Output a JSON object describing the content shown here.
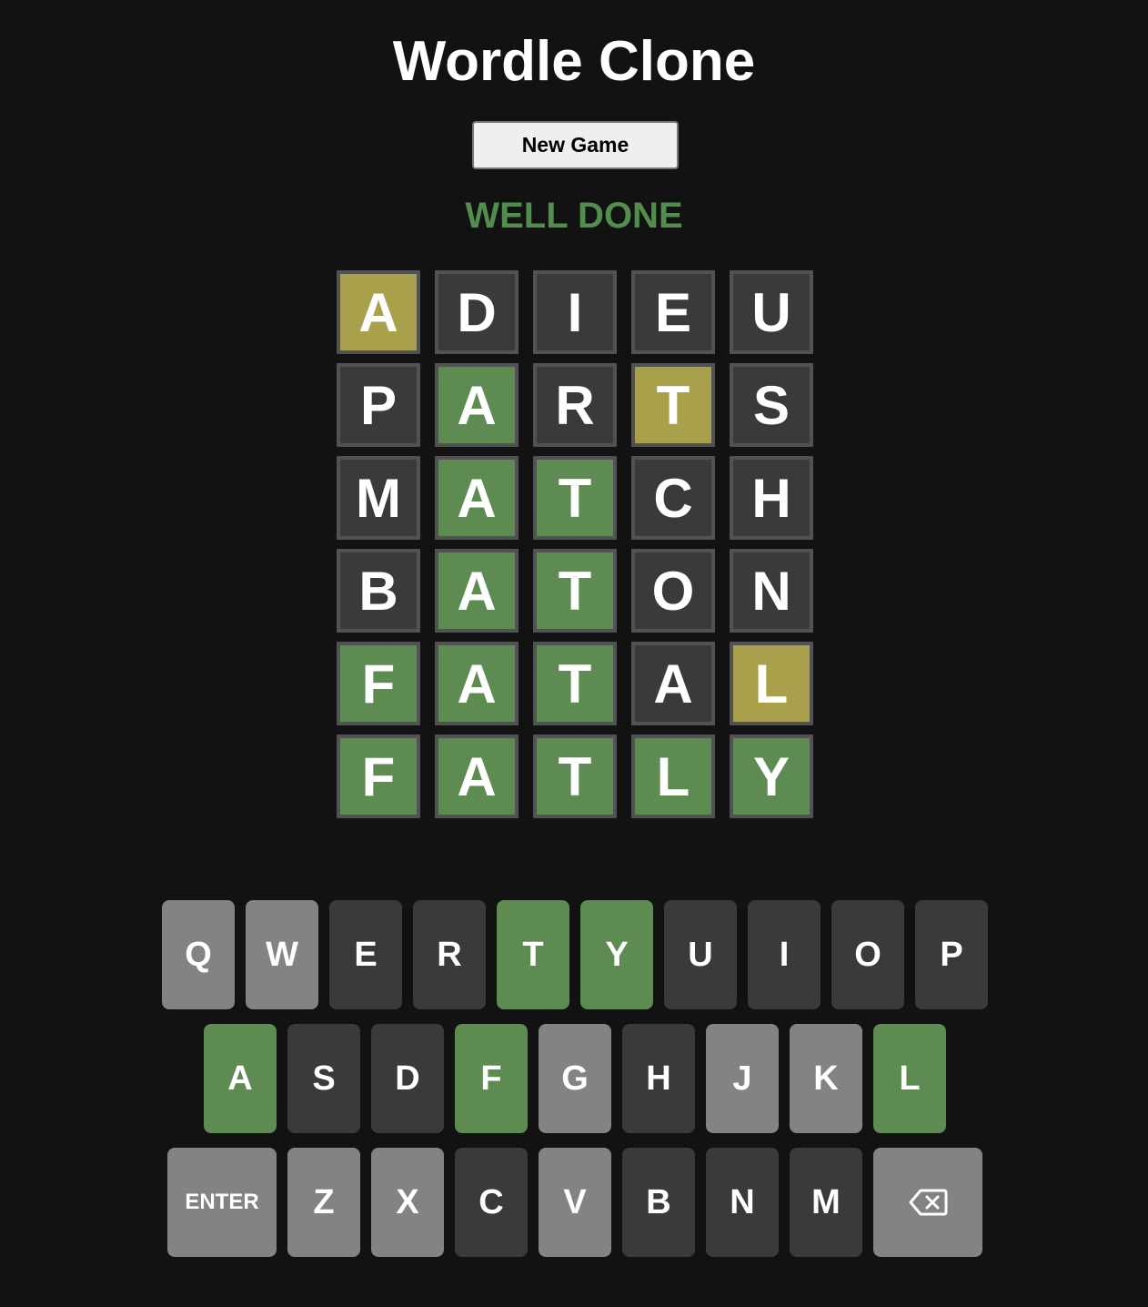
{
  "header": {
    "title": "Wordle Clone",
    "new_game_label": "New Game"
  },
  "status": {
    "message": "WELL DONE",
    "color": "#5e8b52"
  },
  "colors": {
    "background": "#121212",
    "tile_absent": "#3a3a3c",
    "tile_present": "#a9a04b",
    "tile_correct": "#5e8b52",
    "key_used_absent": "#818384",
    "key_unused": "#3a3a3c"
  },
  "board": {
    "rows": [
      [
        {
          "letter": "A",
          "state": "present"
        },
        {
          "letter": "D",
          "state": "absent"
        },
        {
          "letter": "I",
          "state": "absent"
        },
        {
          "letter": "E",
          "state": "absent"
        },
        {
          "letter": "U",
          "state": "absent"
        }
      ],
      [
        {
          "letter": "P",
          "state": "absent"
        },
        {
          "letter": "A",
          "state": "correct"
        },
        {
          "letter": "R",
          "state": "absent"
        },
        {
          "letter": "T",
          "state": "present"
        },
        {
          "letter": "S",
          "state": "absent"
        }
      ],
      [
        {
          "letter": "M",
          "state": "absent"
        },
        {
          "letter": "A",
          "state": "correct"
        },
        {
          "letter": "T",
          "state": "correct"
        },
        {
          "letter": "C",
          "state": "absent"
        },
        {
          "letter": "H",
          "state": "absent"
        }
      ],
      [
        {
          "letter": "B",
          "state": "absent"
        },
        {
          "letter": "A",
          "state": "correct"
        },
        {
          "letter": "T",
          "state": "correct"
        },
        {
          "letter": "O",
          "state": "absent"
        },
        {
          "letter": "N",
          "state": "absent"
        }
      ],
      [
        {
          "letter": "F",
          "state": "correct"
        },
        {
          "letter": "A",
          "state": "correct"
        },
        {
          "letter": "T",
          "state": "correct"
        },
        {
          "letter": "A",
          "state": "absent"
        },
        {
          "letter": "L",
          "state": "present"
        }
      ],
      [
        {
          "letter": "F",
          "state": "correct"
        },
        {
          "letter": "A",
          "state": "correct"
        },
        {
          "letter": "T",
          "state": "correct"
        },
        {
          "letter": "L",
          "state": "correct"
        },
        {
          "letter": "Y",
          "state": "correct"
        }
      ]
    ]
  },
  "keyboard": {
    "rows": [
      [
        {
          "label": "Q",
          "style": "absent-light"
        },
        {
          "label": "W",
          "style": "absent-light"
        },
        {
          "label": "E",
          "style": "dark"
        },
        {
          "label": "R",
          "style": "dark"
        },
        {
          "label": "T",
          "style": "correct"
        },
        {
          "label": "Y",
          "style": "correct"
        },
        {
          "label": "U",
          "style": "dark"
        },
        {
          "label": "I",
          "style": "dark"
        },
        {
          "label": "O",
          "style": "dark"
        },
        {
          "label": "P",
          "style": "dark"
        }
      ],
      [
        {
          "label": "A",
          "style": "correct"
        },
        {
          "label": "S",
          "style": "dark"
        },
        {
          "label": "D",
          "style": "dark"
        },
        {
          "label": "F",
          "style": "correct"
        },
        {
          "label": "G",
          "style": "absent-light"
        },
        {
          "label": "H",
          "style": "dark"
        },
        {
          "label": "J",
          "style": "absent-light"
        },
        {
          "label": "K",
          "style": "absent-light"
        },
        {
          "label": "L",
          "style": "correct"
        }
      ],
      [
        {
          "label": "ENTER",
          "style": "absent-light",
          "wide": true
        },
        {
          "label": "Z",
          "style": "absent-light"
        },
        {
          "label": "X",
          "style": "absent-light"
        },
        {
          "label": "C",
          "style": "dark"
        },
        {
          "label": "V",
          "style": "absent-light"
        },
        {
          "label": "B",
          "style": "dark"
        },
        {
          "label": "N",
          "style": "dark"
        },
        {
          "label": "M",
          "style": "dark"
        },
        {
          "label": "",
          "style": "absent-light",
          "wide": true,
          "icon": "backspace-icon"
        }
      ]
    ]
  }
}
